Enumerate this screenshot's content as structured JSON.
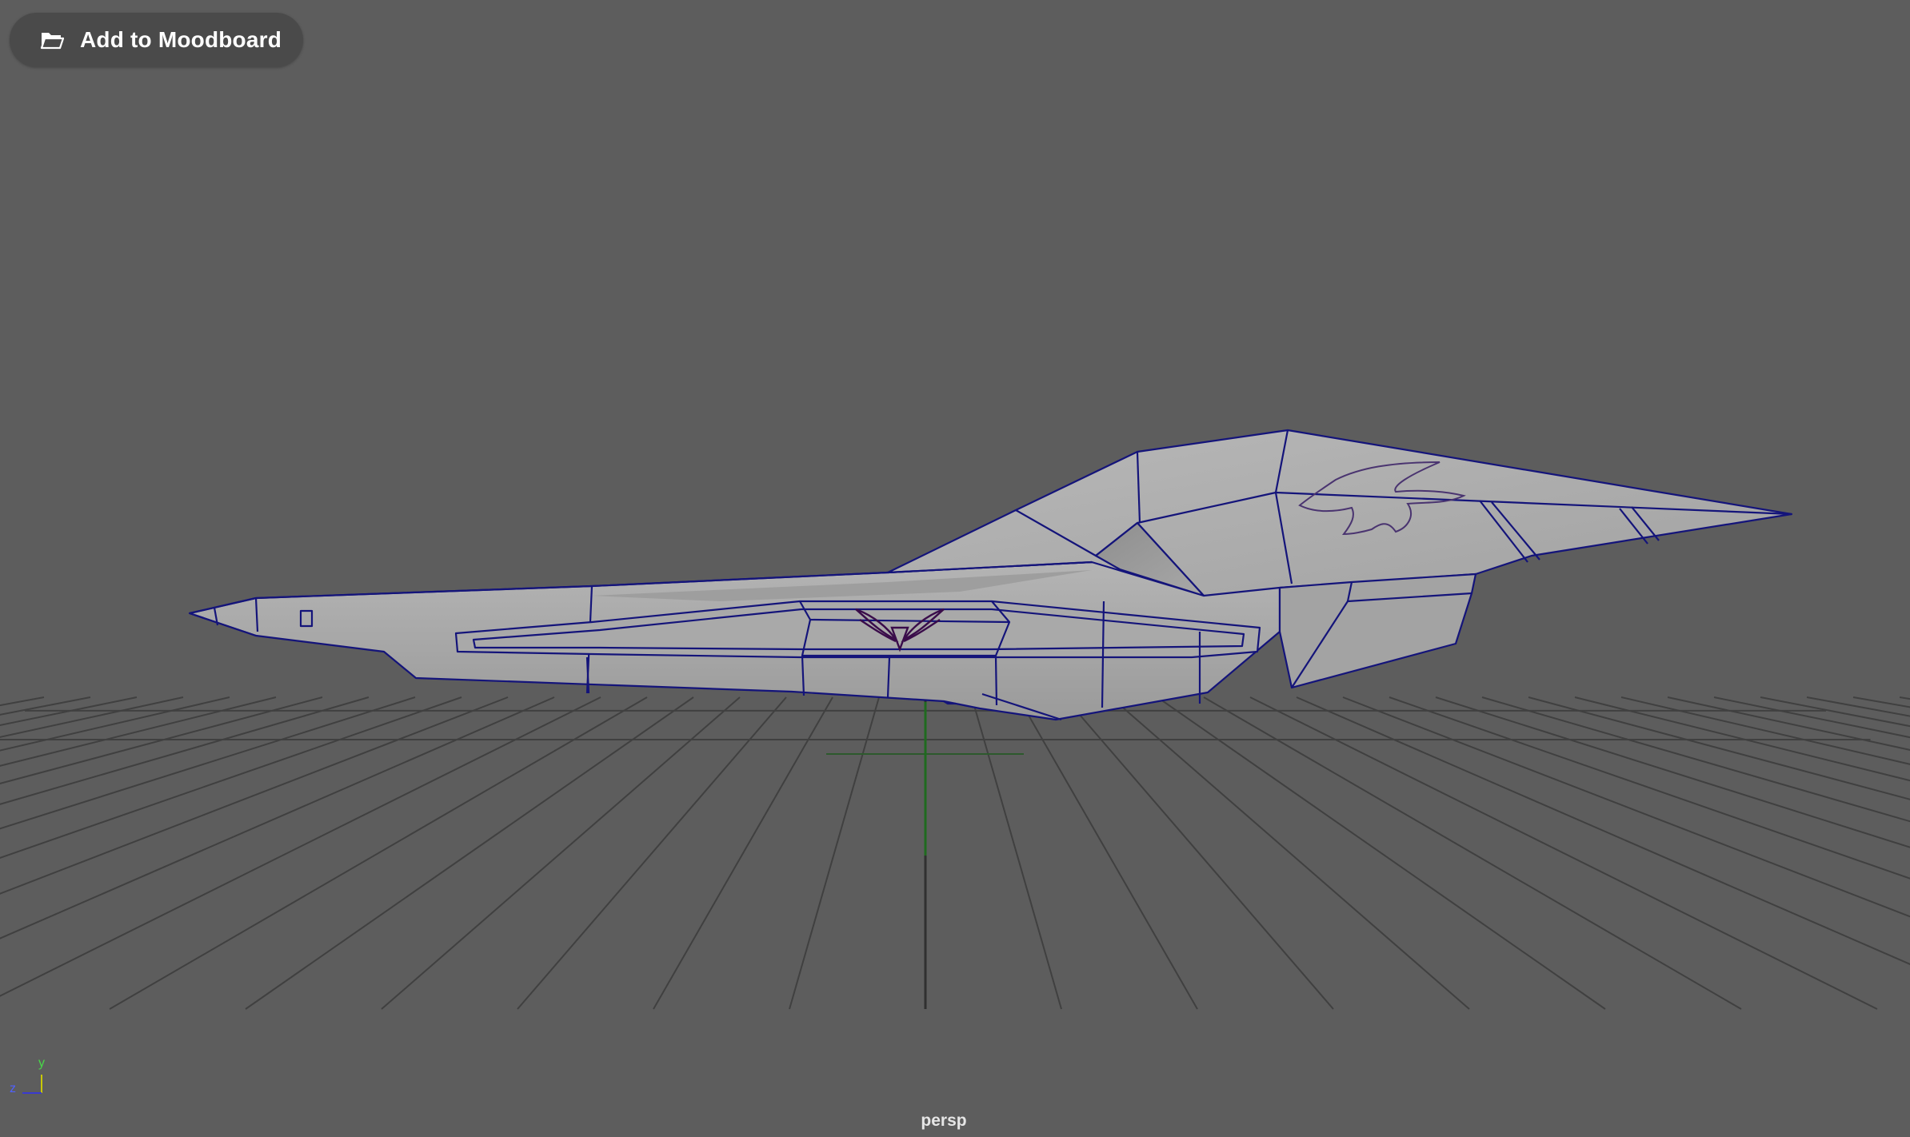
{
  "toolbar": {
    "moodboard_label": "Add to Moodboard",
    "moodboard_icon": "folder-icon"
  },
  "viewport": {
    "camera_name": "persp",
    "background_color": "#5d5d5d",
    "grid_color": "#3f3f3f",
    "wire_color": "#101070",
    "origin_axis_color": "#1f5f1f"
  },
  "axis_gizmo": {
    "y_label": "y",
    "z_label": "z"
  }
}
